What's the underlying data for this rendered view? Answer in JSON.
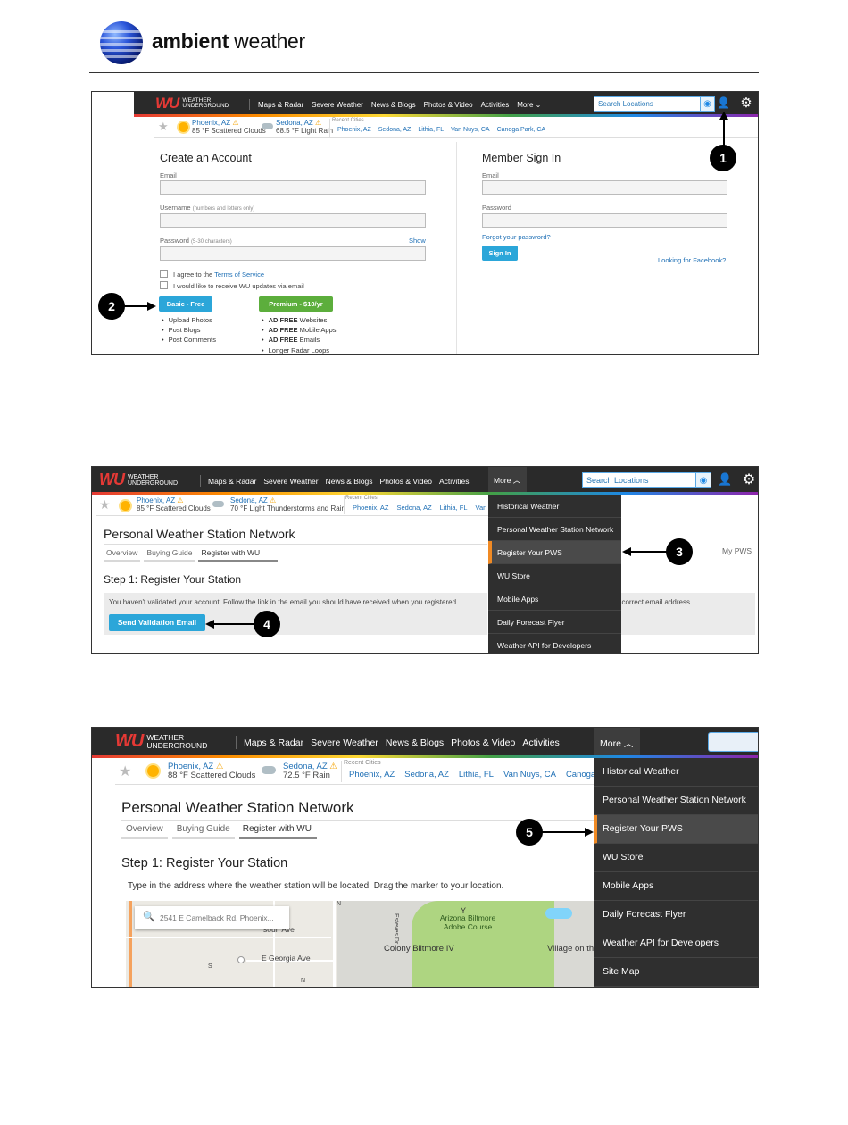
{
  "document": {
    "brand_bold": "ambient",
    "brand_rest": " weather"
  },
  "wu": {
    "logo_mark": "WU",
    "logo_line1": "WEATHER",
    "logo_line2": "UNDERGROUND",
    "nav": [
      "Maps & Radar",
      "Severe Weather",
      "News & Blogs",
      "Photos & Video",
      "Activities",
      "More"
    ],
    "search_placeholder": "Search Locations",
    "recent_label": "Recent Cities",
    "star": "★",
    "warn": "⚠"
  },
  "shot1": {
    "weather": [
      {
        "city": "Phoenix, AZ",
        "cond": "85 °F Scattered Clouds"
      },
      {
        "city": "Sedona, AZ",
        "cond": "68.5 °F Light Rain"
      }
    ],
    "recent_cities": [
      "Phoenix, AZ",
      "Sedona, AZ",
      "Lithia, FL",
      "Van Nuys, CA",
      "Canoga Park, CA"
    ],
    "create": {
      "title": "Create an Account",
      "email_label": "Email",
      "username_label": "Username",
      "username_hint": "(numbers and letters only)",
      "password_label": "Password",
      "password_hint": "(5-30 characters)",
      "show": "Show",
      "agree_prefix": "I agree to the ",
      "terms": "Terms of Service",
      "updates": "I would like to receive WU updates via email",
      "basic_button": "Basic - Free",
      "premium_button": "Premium - $10/yr",
      "basic_features": [
        "Upload Photos",
        "Post Blogs",
        "Post Comments"
      ],
      "premium_features": [
        {
          "bold": "AD FREE",
          "rest": " Websites"
        },
        {
          "bold": "AD FREE",
          "rest": " Mobile Apps"
        },
        {
          "bold": "AD FREE",
          "rest": " Emails"
        },
        {
          "bold": "",
          "rest": "Longer Radar Loops"
        }
      ]
    },
    "signin": {
      "title": "Member Sign In",
      "email_label": "Email",
      "password_label": "Password",
      "forgot": "Forgot your password?",
      "button": "Sign In",
      "facebook": "Looking for Facebook?"
    },
    "callouts": [
      "1",
      "2"
    ]
  },
  "shot2": {
    "weather": [
      {
        "city": "Phoenix, AZ",
        "cond": "85 °F Scattered Clouds"
      },
      {
        "city": "Sedona, AZ",
        "cond": "70 °F Light Thunderstorms and Rain"
      }
    ],
    "recent_cities": [
      "Phoenix, AZ",
      "Sedona, AZ",
      "Lithia, FL",
      "Van N"
    ],
    "page_title": "Personal Weather Station Network",
    "tabs": [
      "Overview",
      "Buying Guide",
      "Register with WU"
    ],
    "my_pws": "My PWS",
    "step_title": "Step 1: Register Your Station",
    "notice_left": "You haven't validated your account. Follow the link in the email you should have received when you registered",
    "notice_right": "ed the correct email address.",
    "send_button": "Send Validation Email",
    "menu": [
      "Historical Weather",
      "Personal Weather Station Network",
      "Register Your PWS",
      "WU Store",
      "Mobile Apps",
      "Daily Forecast Flyer",
      "Weather API for Developers"
    ],
    "callouts": [
      "3",
      "4"
    ]
  },
  "shot3": {
    "weather": [
      {
        "city": "Phoenix, AZ",
        "cond": "88 °F Scattered Clouds"
      },
      {
        "city": "Sedona, AZ",
        "cond": "72.5 °F Rain"
      }
    ],
    "recent_cities": [
      "Phoenix, AZ",
      "Sedona, AZ",
      "Lithia, FL",
      "Van Nuys, CA",
      "Canoga Park"
    ],
    "page_title": "Personal Weather Station Network",
    "tabs": [
      "Overview",
      "Buying Guide",
      "Register with WU"
    ],
    "step_title": "Step 1: Register Your Station",
    "instructions": "Type in the address where the weather station will be located. Drag the marker to your location.",
    "map_search": "2541 E Camelback Rd, Phoenix...",
    "map_labels": {
      "street1": "souri Ave",
      "street2": "E Georgia Ave",
      "poi": "Arizona Biltmore Adobe Course",
      "poi2": "Colony Biltmore IV",
      "poi3": "Village on th",
      "side1": "N",
      "side2": "Esteves Dr",
      "side3": "S",
      "side4": "N"
    },
    "menu": [
      "Historical Weather",
      "Personal Weather Station Network",
      "Register Your PWS",
      "WU Store",
      "Mobile Apps",
      "Daily Forecast Flyer",
      "Weather API for Developers",
      "Site Map"
    ],
    "callouts": [
      "5"
    ]
  }
}
